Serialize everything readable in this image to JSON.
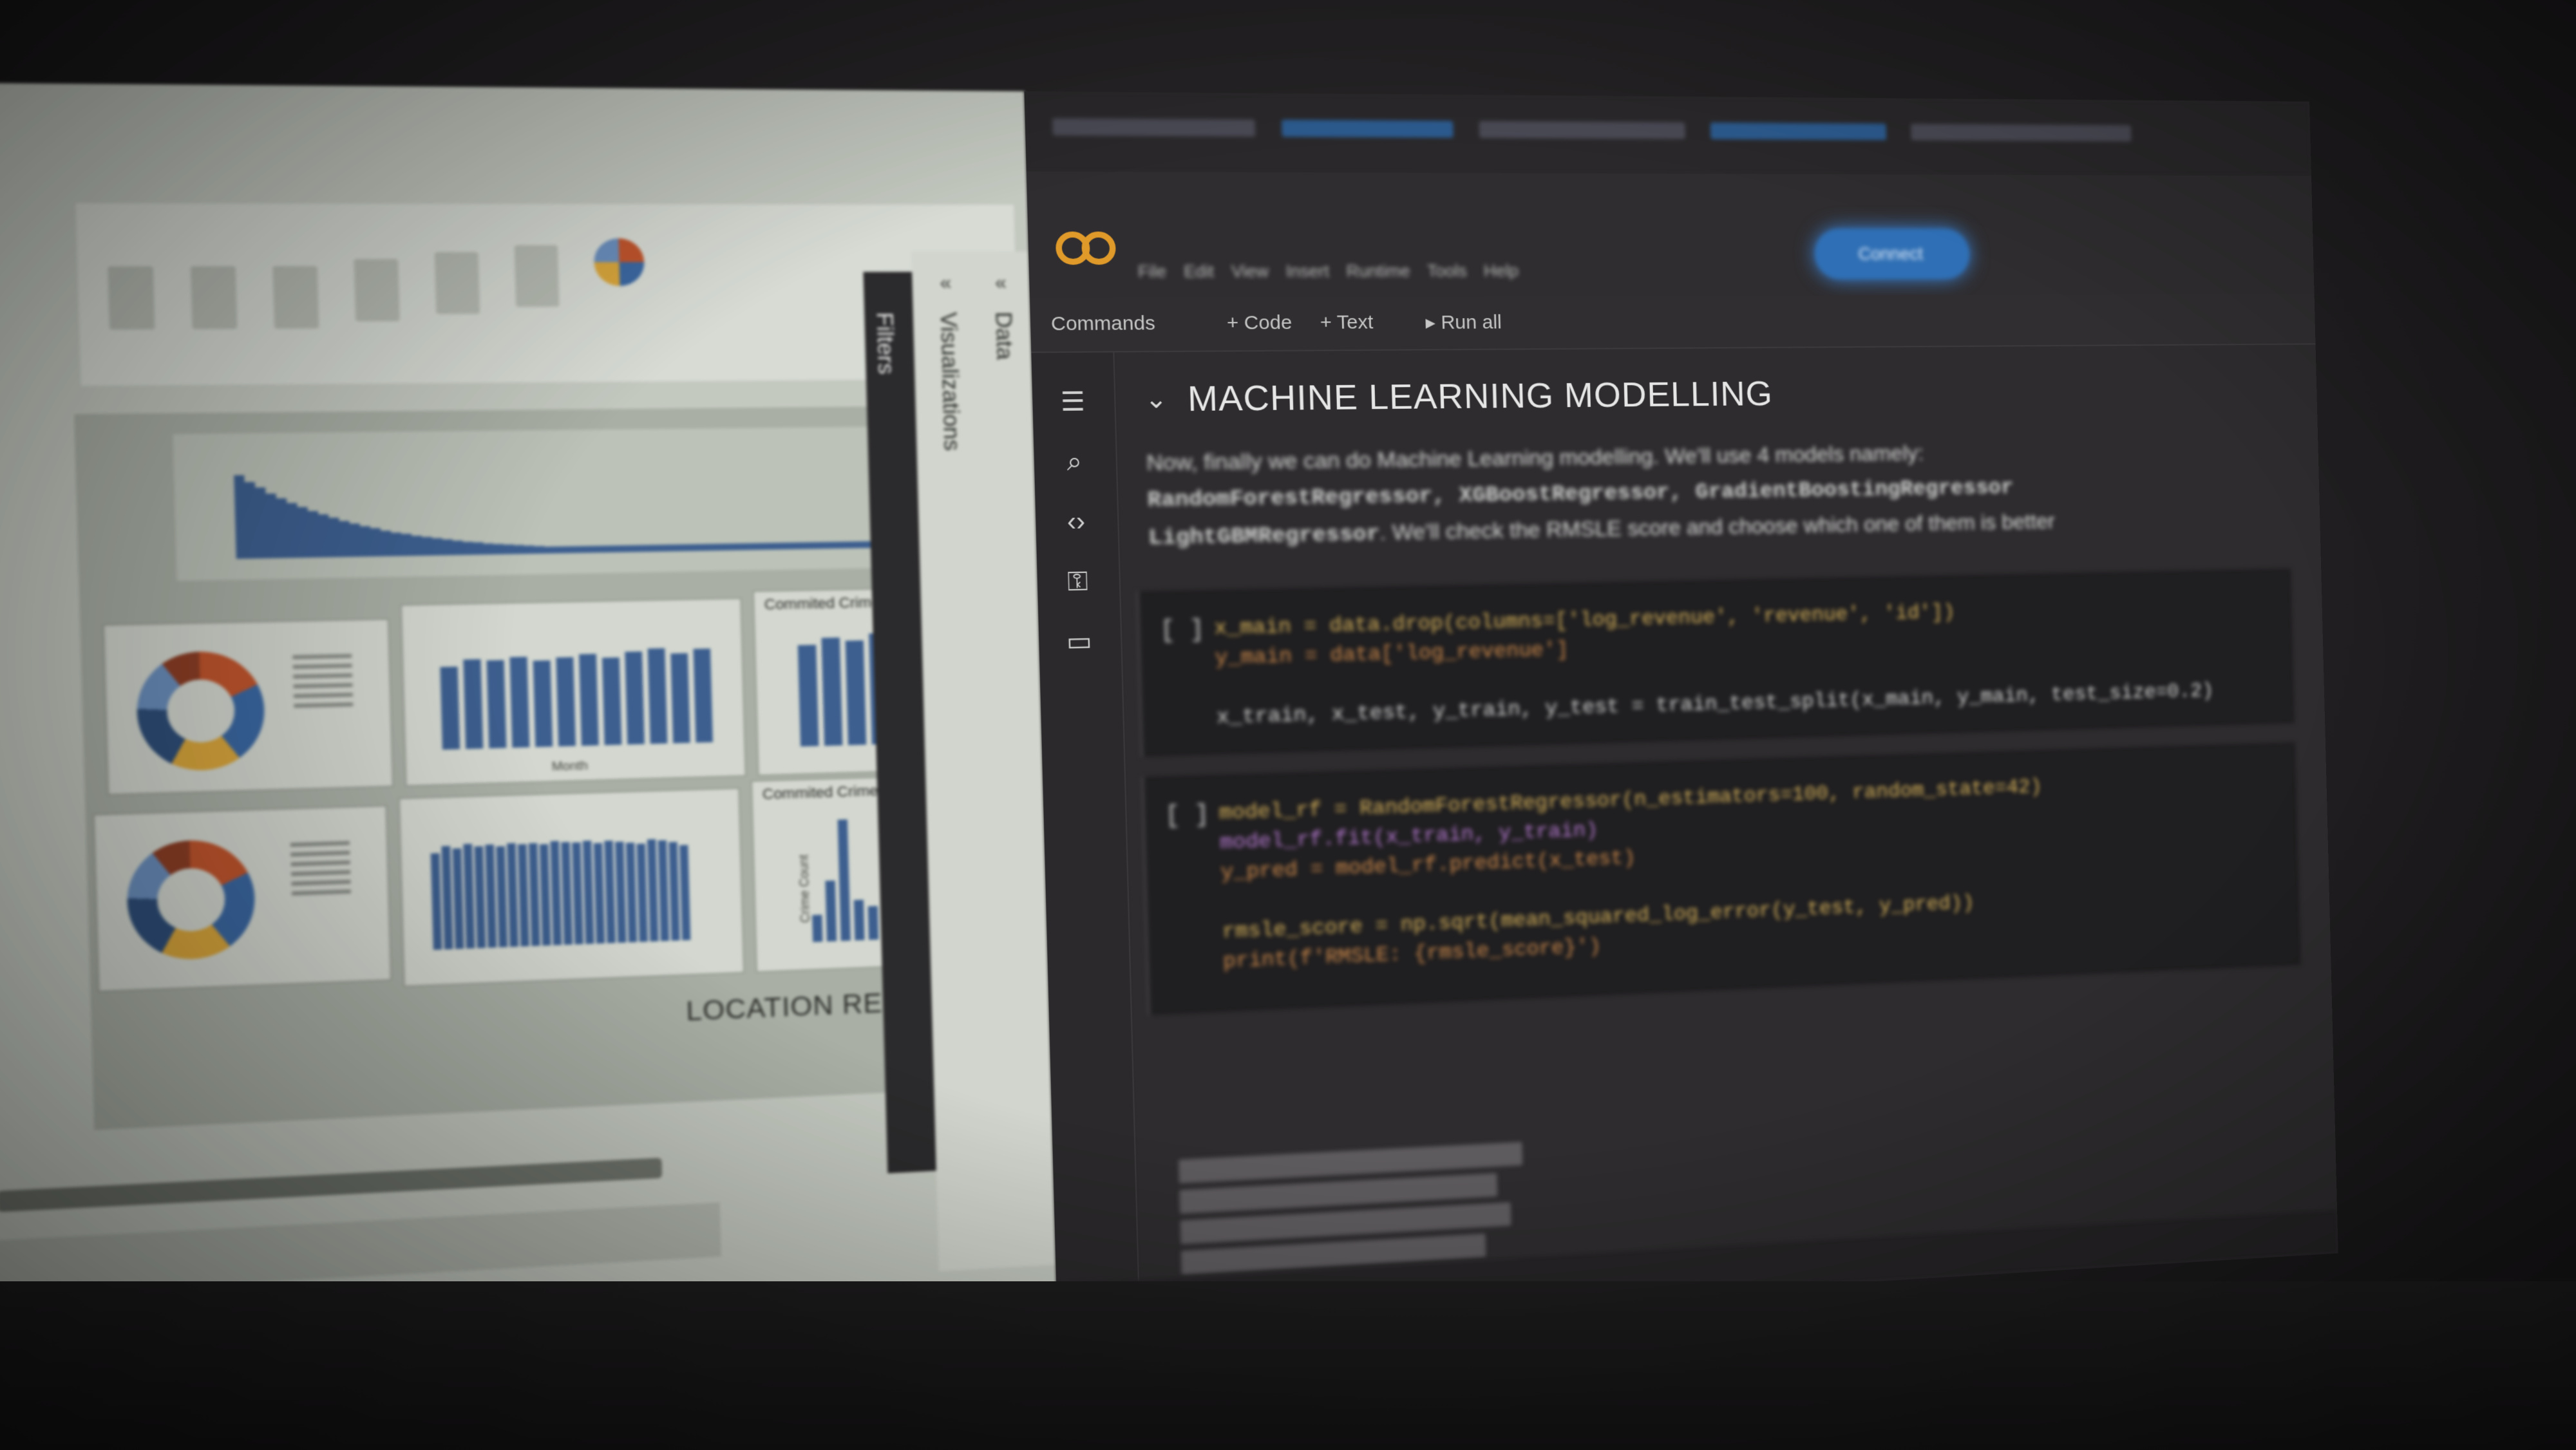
{
  "powerbi": {
    "report_title": "LOCATION RE",
    "panes": {
      "filters_label": "Filters",
      "visualizations_label": "Visualizations",
      "data_label": "Data"
    },
    "visuals": [
      {
        "title": "Commited Crimes per Year"
      },
      {
        "title": "Commited Crimes per Hour"
      }
    ],
    "axis": {
      "y_label": "Crime Count",
      "x_label": "Month"
    }
  },
  "colab": {
    "menu": [
      "File",
      "Edit",
      "View",
      "Insert",
      "Runtime",
      "Tools",
      "Help"
    ],
    "toolbar": {
      "commands": "Commands",
      "add_code": "+ Code",
      "add_text": "+ Text",
      "run_all": "▸ Run all"
    },
    "sidebar_icons": [
      "table-of-contents-icon",
      "find-icon",
      "code-snippets-icon",
      "secrets-key-icon",
      "files-folder-icon"
    ],
    "section": {
      "title": "MACHINE LEARNING MODELLING",
      "paragraph_text": "Now, finally we can do Machine Learning modelling. We'll use 4 models namely:",
      "paragraph_code": "RandomForestRegressor, XGBoostRegressor, GradientBoostingRegressor",
      "paragraph_code2": "LightGBMRegressor",
      "paragraph_tail": ". We'll check the RMSLE score and choose which one of them is better"
    },
    "cells": [
      {
        "bracket": "[ ]",
        "lines": [
          "x_main = data.drop(columns=['log_revenue', 'revenue', 'id'])",
          "y_main = data['log_revenue']",
          "",
          "x_train, x_test, y_train, y_test = train_test_split(x_main, y_main, test_size=0.2)"
        ]
      },
      {
        "bracket": "[ ]",
        "lines": [
          "model_rf = RandomForestRegressor(n_estimators=100, random_state=42)",
          "model_rf.fit(x_train, y_train)",
          "y_pred = model_rf.predict(x_test)",
          "",
          "rmsle_score = np.sqrt(mean_squared_log_error(y_test, y_pred))",
          "print(f'RMSLE: {rmsle_score}')"
        ]
      }
    ],
    "connect_label": "Connect"
  }
}
